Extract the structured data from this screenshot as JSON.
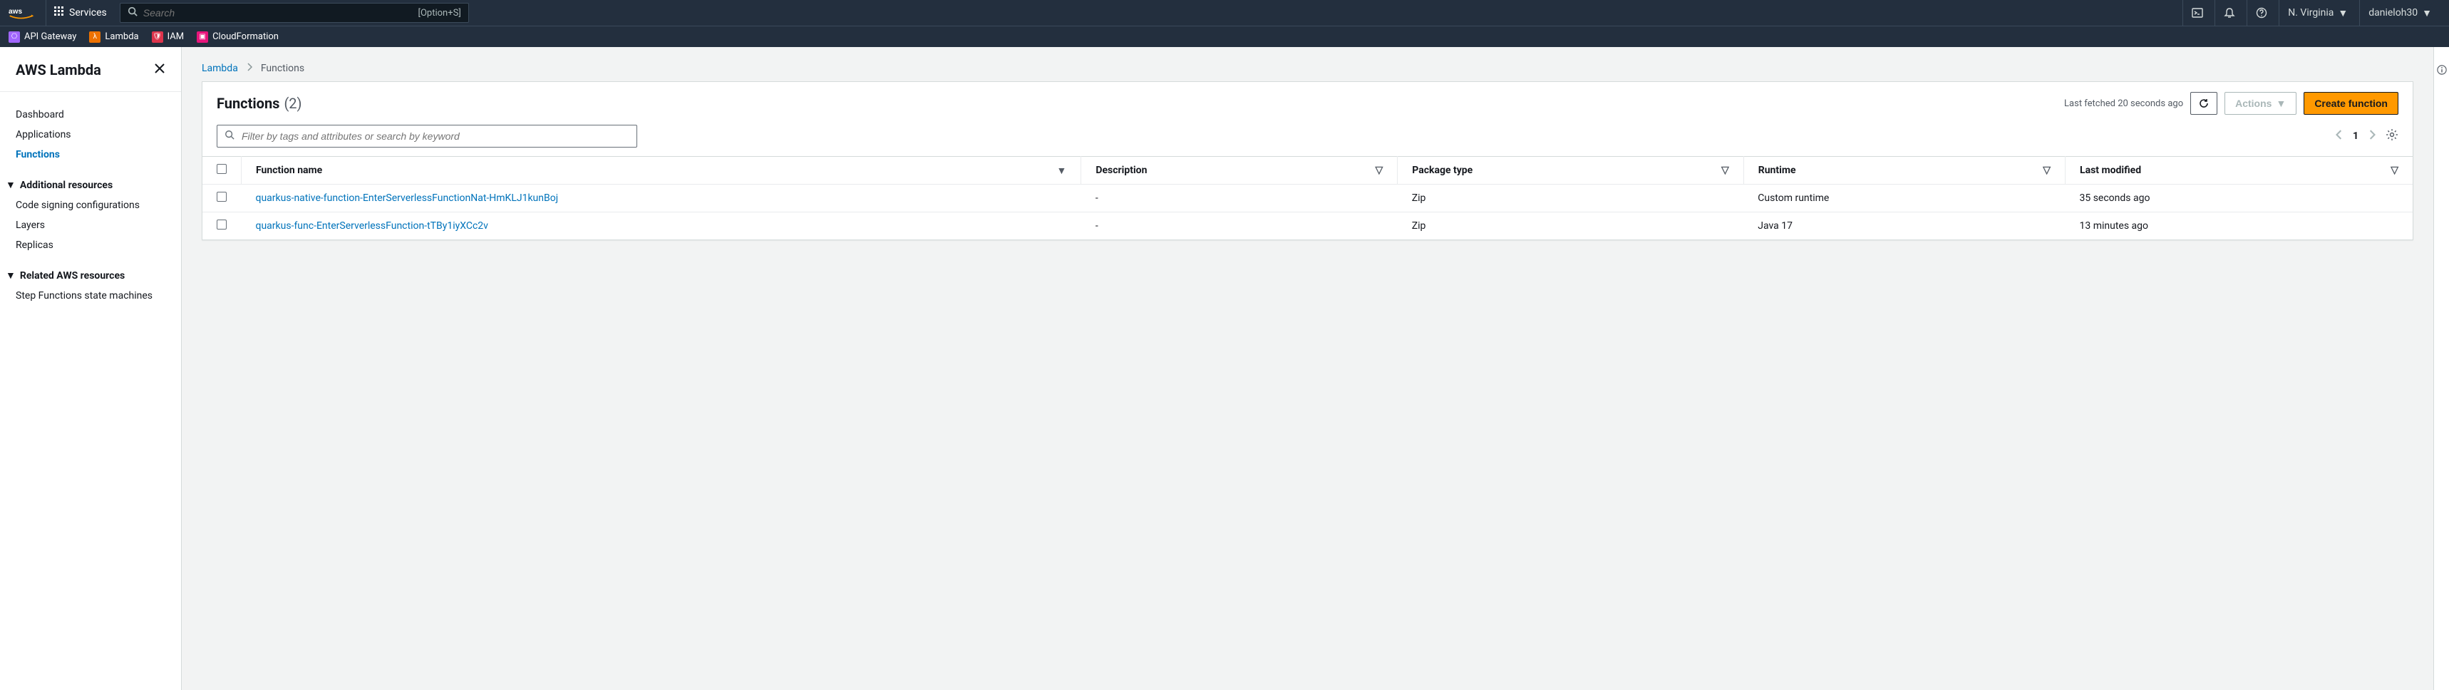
{
  "topnav": {
    "services_label": "Services",
    "search_placeholder": "Search",
    "search_shortcut": "[Option+S]",
    "region": "N. Virginia",
    "user": "danieloh30"
  },
  "servicebar": {
    "api_gateway": "API Gateway",
    "lambda": "Lambda",
    "iam": "IAM",
    "cloudformation": "CloudFormation"
  },
  "sidebar": {
    "title": "AWS Lambda",
    "nav": {
      "dashboard": "Dashboard",
      "applications": "Applications",
      "functions": "Functions"
    },
    "additional": {
      "label": "Additional resources",
      "code_signing": "Code signing configurations",
      "layers": "Layers",
      "replicas": "Replicas"
    },
    "related": {
      "label": "Related AWS resources",
      "step_functions": "Step Functions state machines"
    }
  },
  "breadcrumb": {
    "lambda": "Lambda",
    "functions": "Functions"
  },
  "panel": {
    "title": "Functions",
    "count": "(2)",
    "last_fetched": "Last fetched 20 seconds ago",
    "actions_label": "Actions",
    "create_label": "Create function",
    "filter_placeholder": "Filter by tags and attributes or search by keyword",
    "page": "1"
  },
  "columns": {
    "function_name": "Function name",
    "description": "Description",
    "package_type": "Package type",
    "runtime": "Runtime",
    "last_modified": "Last modified"
  },
  "rows": [
    {
      "name": "quarkus-native-function-EnterServerlessFunctionNat-HmKLJ1kunBoj",
      "description": "-",
      "package_type": "Zip",
      "runtime": "Custom runtime",
      "last_modified": "35 seconds ago"
    },
    {
      "name": "quarkus-func-EnterServerlessFunction-tTBy1iyXCc2v",
      "description": "-",
      "package_type": "Zip",
      "runtime": "Java 17",
      "last_modified": "13 minutes ago"
    }
  ]
}
